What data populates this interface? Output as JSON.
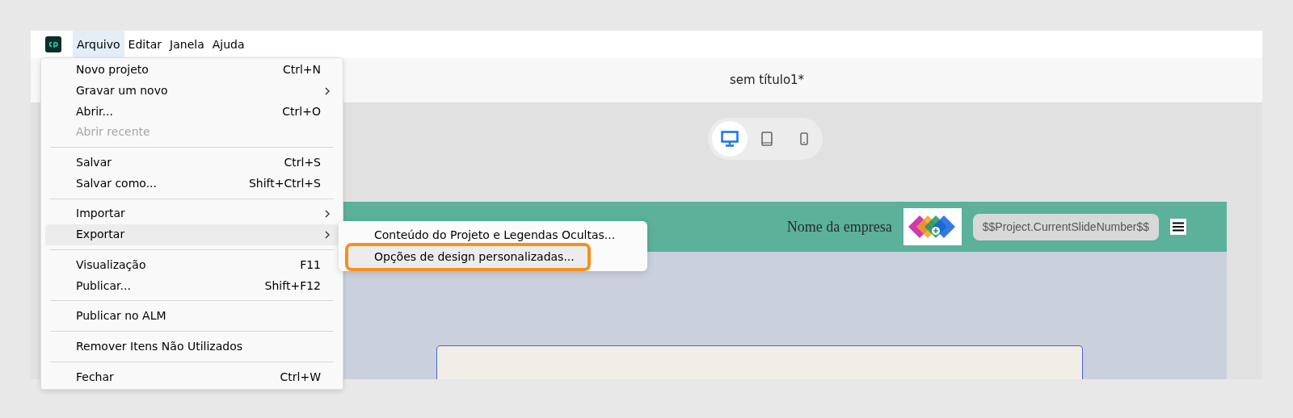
{
  "menu_bar": [
    {
      "label": "Arquivo",
      "selected": true
    },
    {
      "label": "Editar",
      "selected": false
    },
    {
      "label": "Janela",
      "selected": false
    },
    {
      "label": "Ajuda",
      "selected": false
    }
  ],
  "document_title": "sem título1*",
  "device_toggles": [
    {
      "kind": "desktop",
      "selected": true
    },
    {
      "kind": "tablet",
      "selected": false
    },
    {
      "kind": "phone",
      "selected": false
    }
  ],
  "slide": {
    "company_name": "Nome da empresa",
    "slide_number_field": "$$Project.CurrentSlideNumber$$"
  },
  "file_menu": [
    {
      "kind": "item",
      "label": "Novo projeto",
      "shortcut": "Ctrl+N",
      "disabled": false,
      "submenu": false,
      "selected": false
    },
    {
      "kind": "item",
      "label": "Gravar um novo",
      "disabled": false,
      "submenu": true,
      "selected": false
    },
    {
      "kind": "item",
      "label": "Abrir...",
      "shortcut": "Ctrl+O",
      "disabled": false,
      "submenu": false,
      "selected": false
    },
    {
      "kind": "item",
      "label": "Abrir recente",
      "disabled": true,
      "submenu": false,
      "selected": false
    },
    {
      "kind": "separator"
    },
    {
      "kind": "item",
      "label": "Salvar",
      "shortcut": "Ctrl+S",
      "disabled": false,
      "submenu": false,
      "selected": false
    },
    {
      "kind": "item",
      "label": "Salvar como...",
      "shortcut": "Shift+Ctrl+S",
      "disabled": false,
      "submenu": false,
      "selected": false
    },
    {
      "kind": "separator"
    },
    {
      "kind": "item",
      "label": "Importar",
      "disabled": false,
      "submenu": true,
      "selected": false
    },
    {
      "kind": "item",
      "label": "Exportar",
      "disabled": false,
      "submenu": true,
      "selected": true
    },
    {
      "kind": "separator"
    },
    {
      "kind": "item",
      "label": "Visualização",
      "shortcut": "F11",
      "disabled": false,
      "submenu": false,
      "selected": false
    },
    {
      "kind": "item",
      "label": "Publicar...",
      "shortcut": "Shift+F12",
      "disabled": false,
      "submenu": false,
      "selected": false
    },
    {
      "kind": "separator"
    },
    {
      "kind": "item",
      "label": "Publicar no ALM",
      "disabled": false,
      "submenu": false,
      "selected": false
    },
    {
      "kind": "separator"
    },
    {
      "kind": "item",
      "label": "Remover Itens Não Utilizados",
      "disabled": false,
      "submenu": false,
      "selected": false
    },
    {
      "kind": "separator"
    },
    {
      "kind": "item",
      "label": "Fechar",
      "shortcut": "Ctrl+W",
      "disabled": false,
      "submenu": false,
      "selected": false
    }
  ],
  "export_submenu": [
    {
      "label": "Conteúdo do Projeto e Legendas Ocultas...",
      "selected": false,
      "highlighted": false
    },
    {
      "label": "Opções de design personalizadas...",
      "selected": true,
      "highlighted": true
    }
  ]
}
